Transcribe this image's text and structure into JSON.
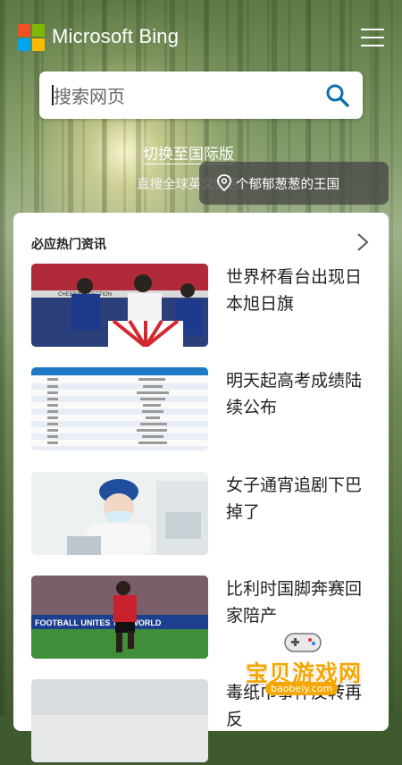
{
  "header": {
    "brand": "Microsoft Bing",
    "logo_colors": [
      "#f25022",
      "#7fba00",
      "#00a4ef",
      "#ffb900"
    ],
    "menu_icon": "hamburger-menu-icon"
  },
  "search": {
    "placeholder": "搜索网页",
    "value": "",
    "button_icon": "search-icon",
    "icon_color": "#0b6fb0"
  },
  "switch_link": "切换至国际版",
  "tagline": "直搜全球英文信息",
  "location_tooltip": {
    "icon": "location-pin-icon",
    "text": "个郁郁葱葱的王国"
  },
  "news": {
    "section_title": "必应热门资讯",
    "arrow_icon": "chevron-right-icon",
    "items": [
      {
        "title": "世界杯看台出现日本旭日旗"
      },
      {
        "title": "明天起高考成绩陆续公布"
      },
      {
        "title": "女子通宵追剧下巴掉了"
      },
      {
        "title": "比利时国脚奔赛回家陪产"
      },
      {
        "title": "毒纸巾事件反转再反"
      }
    ],
    "thumb1_banner": "CHEERING SECTION",
    "thumb4_banner": "FOOTBALL UNITES THE WORLD"
  },
  "watermark": {
    "text": "宝贝游戏网",
    "url": "baobeiy.com"
  }
}
